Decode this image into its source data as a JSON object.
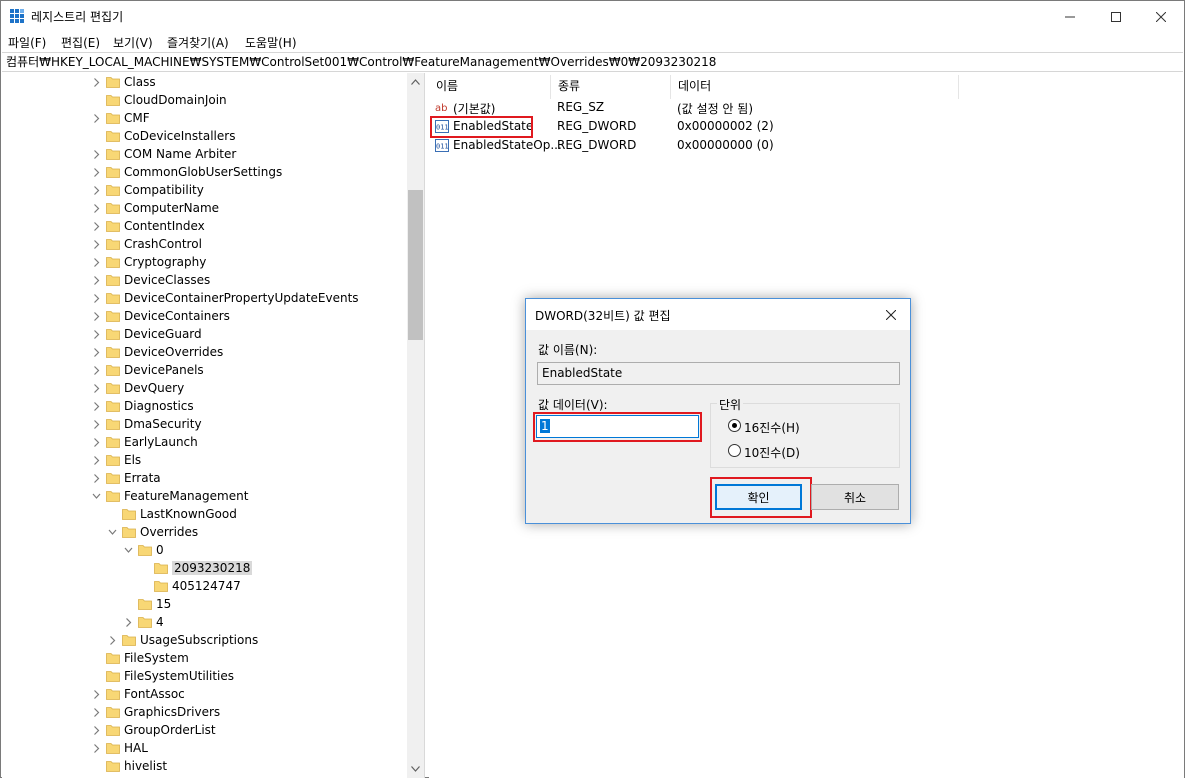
{
  "window": {
    "title": "레지스트리 편집기",
    "minimize_icon": "minimize-icon",
    "maximize_icon": "maximize-icon",
    "close_icon": "close-icon"
  },
  "menu": [
    "파일(F)",
    "편집(E)",
    "보기(V)",
    "즐겨찾기(A)",
    "도움말(H)"
  ],
  "address": "컴퓨터₩HKEY_LOCAL_MACHINE₩SYSTEM₩ControlSet001₩Control₩FeatureManagement₩Overrides₩0₩2093230218",
  "tree": {
    "items": [
      {
        "label": "Class",
        "expander": "collapsed"
      },
      {
        "label": "CloudDomainJoin",
        "expander": "none"
      },
      {
        "label": "CMF",
        "expander": "collapsed"
      },
      {
        "label": "CoDeviceInstallers",
        "expander": "none"
      },
      {
        "label": "COM Name Arbiter",
        "expander": "collapsed"
      },
      {
        "label": "CommonGlobUserSettings",
        "expander": "collapsed"
      },
      {
        "label": "Compatibility",
        "expander": "collapsed"
      },
      {
        "label": "ComputerName",
        "expander": "collapsed"
      },
      {
        "label": "ContentIndex",
        "expander": "collapsed"
      },
      {
        "label": "CrashControl",
        "expander": "collapsed"
      },
      {
        "label": "Cryptography",
        "expander": "collapsed"
      },
      {
        "label": "DeviceClasses",
        "expander": "collapsed"
      },
      {
        "label": "DeviceContainerPropertyUpdateEvents",
        "expander": "collapsed"
      },
      {
        "label": "DeviceContainers",
        "expander": "collapsed"
      },
      {
        "label": "DeviceGuard",
        "expander": "collapsed"
      },
      {
        "label": "DeviceOverrides",
        "expander": "collapsed"
      },
      {
        "label": "DevicePanels",
        "expander": "collapsed"
      },
      {
        "label": "DevQuery",
        "expander": "collapsed"
      },
      {
        "label": "Diagnostics",
        "expander": "collapsed"
      },
      {
        "label": "DmaSecurity",
        "expander": "collapsed"
      },
      {
        "label": "EarlyLaunch",
        "expander": "collapsed"
      },
      {
        "label": "Els",
        "expander": "collapsed"
      },
      {
        "label": "Errata",
        "expander": "collapsed"
      },
      {
        "label": "FeatureManagement",
        "expander": "expanded"
      },
      {
        "label": "LastKnownGood",
        "expander": "none"
      },
      {
        "label": "Overrides",
        "expander": "expanded"
      },
      {
        "label": "0",
        "expander": "expanded"
      },
      {
        "label": "2093230218",
        "expander": "none"
      },
      {
        "label": "405124747",
        "expander": "none"
      },
      {
        "label": "15",
        "expander": "none"
      },
      {
        "label": "4",
        "expander": "collapsed"
      },
      {
        "label": "UsageSubscriptions",
        "expander": "collapsed"
      },
      {
        "label": "FileSystem",
        "expander": "none"
      },
      {
        "label": "FileSystemUtilities",
        "expander": "none"
      },
      {
        "label": "FontAssoc",
        "expander": "collapsed"
      },
      {
        "label": "GraphicsDrivers",
        "expander": "collapsed"
      },
      {
        "label": "GroupOrderList",
        "expander": "collapsed"
      },
      {
        "label": "HAL",
        "expander": "collapsed"
      },
      {
        "label": "hivelist",
        "expander": "none"
      }
    ],
    "selected": "2093230218"
  },
  "list": {
    "columns": [
      "이름",
      "종류",
      "데이터"
    ],
    "rows": [
      {
        "icon": "string-value-icon",
        "name": "(기본값)",
        "type": "REG_SZ",
        "data": "(값 설정 안 됨)"
      },
      {
        "icon": "binary-value-icon",
        "name": "EnabledState",
        "type": "REG_DWORD",
        "data": "0x00000002 (2)"
      },
      {
        "icon": "binary-value-icon",
        "name": "EnabledStateOp...",
        "type": "REG_DWORD",
        "data": "0x00000000 (0)"
      }
    ],
    "string_icon_text": "ab",
    "binary_icon_text": "011"
  },
  "dialog": {
    "title": "DWORD(32비트) 값 편집",
    "value_name_label": "값 이름(N):",
    "value_name": "EnabledState",
    "value_data_label": "값 데이터(V):",
    "value_data": "1",
    "base_label": "단위",
    "hex_label": "16진수(H)",
    "dec_label": "10진수(D)",
    "selected_base": "hex",
    "ok_label": "확인",
    "cancel_label": "취소"
  },
  "colors": {
    "highlight_red": "#e0191f",
    "accent_blue": "#0078d7",
    "folder_yellow": "#f8d775"
  }
}
